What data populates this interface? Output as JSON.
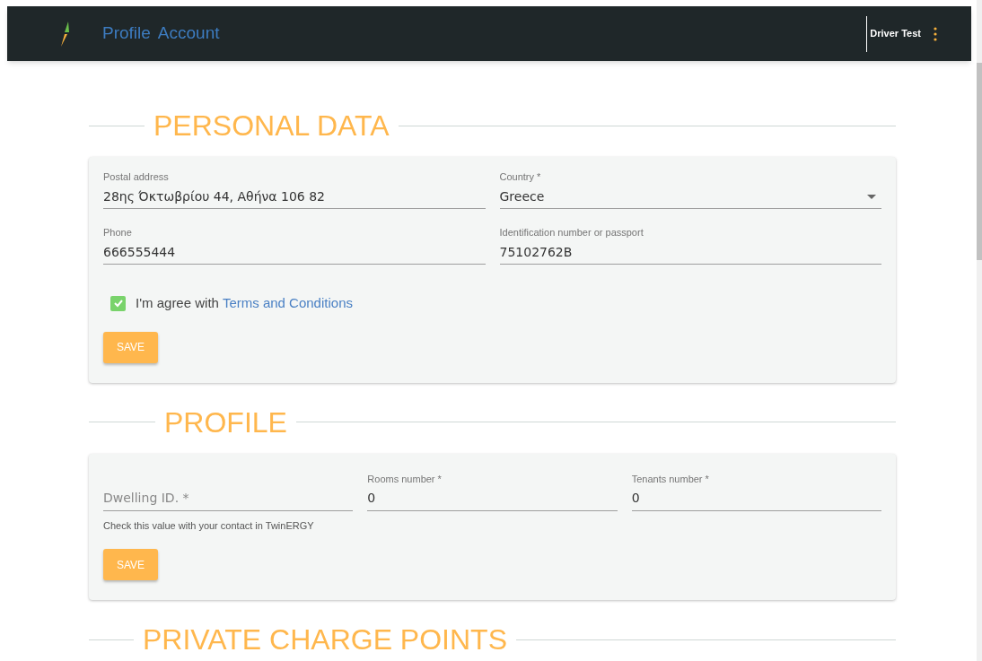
{
  "navbar": {
    "links": [
      {
        "label": "Profile"
      },
      {
        "label": "Account"
      }
    ],
    "user": "Driver Test"
  },
  "sections": [
    {
      "title": "PERSONAL DATA",
      "fields": [
        {
          "kind": "text",
          "label": "Postal address",
          "value": "28ης Όκτωβρίου 44, Αθήνα 106 82"
        },
        {
          "kind": "select",
          "label": "Country *",
          "value": "Greece"
        },
        {
          "kind": "text",
          "label": "Phone",
          "value": "666555444"
        },
        {
          "kind": "text",
          "label": "Identification number or passport",
          "value": "75102762B"
        }
      ],
      "agreement": {
        "checked": true,
        "text": "I'm agree with",
        "link": "Terms and Conditions"
      },
      "button": "SAVE"
    },
    {
      "title": "PROFILE",
      "fields": [
        {
          "kind": "text",
          "placeholder": "Dwelling ID. *",
          "helper": "Check this value with your contact in TwinERGY"
        },
        {
          "kind": "text",
          "label": "Rooms number *",
          "value": "0"
        },
        {
          "kind": "text",
          "label": "Tenants number *",
          "value": "0"
        }
      ],
      "button": "SAVE"
    },
    {
      "title": "PRIVATE CHARGE POINTS"
    }
  ]
}
